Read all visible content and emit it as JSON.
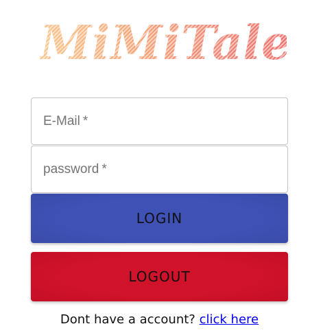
{
  "brand": {
    "logo_text": "MiMiTale",
    "colors": {
      "logo_start": "#f9c58d",
      "logo_end": "#ec6f6b"
    }
  },
  "form": {
    "email": {
      "label": "E-Mail",
      "required_marker": "*",
      "value": ""
    },
    "password": {
      "label": "password",
      "required_marker": "*",
      "value": ""
    }
  },
  "buttons": {
    "login_label": "LOGIN",
    "logout_label": "LOGOUT",
    "colors": {
      "login": "#3f51b5",
      "logout": "#d0122a"
    }
  },
  "signup": {
    "prompt": "Dont have a account?",
    "link_label": "click here",
    "link_color": "#0000ee"
  }
}
